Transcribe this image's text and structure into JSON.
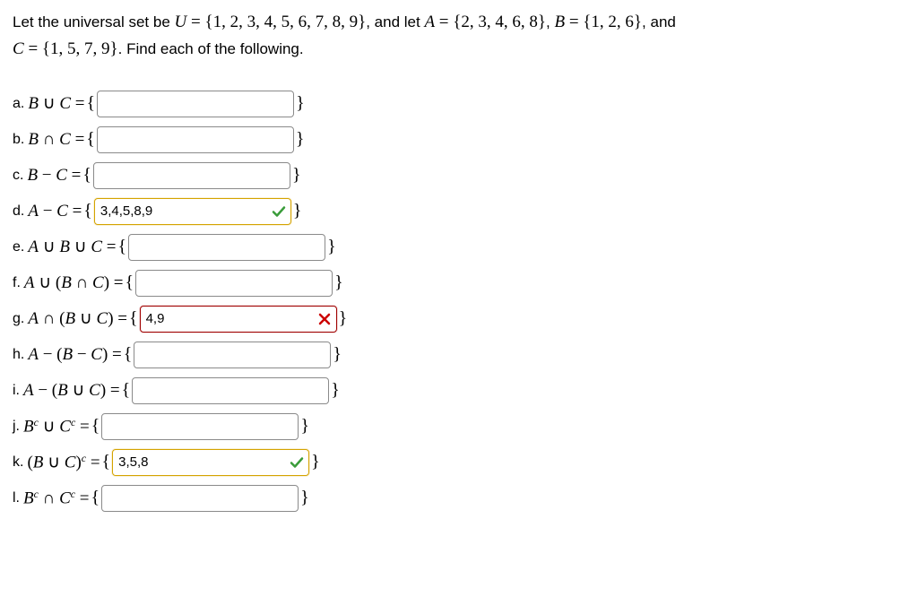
{
  "problem": {
    "text_prefix": "Let the universal set be ",
    "U_sym": "U",
    "U_set": " = {1, 2, 3, 4, 5, 6, 7, 8, 9}",
    "mid1": ", and let ",
    "A_sym": "A",
    "A_set": " = {2, 3, 4, 6, 8}",
    "sep1": ", ",
    "B_sym": "B",
    "B_set": " = {1, 2, 6}",
    "mid2": ", and",
    "C_sym": "C",
    "C_set": " = {1, 5, 7, 9}",
    "suffix": ". Find each of the following."
  },
  "parts": [
    {
      "letter": "a.",
      "expr_html": "<span class='math-i'>B</span> <span class='math'>∪</span> <span class='math-i'>C</span> <span class='math'>=</span>",
      "value": "",
      "status": ""
    },
    {
      "letter": "b.",
      "expr_html": "<span class='math-i'>B</span> <span class='math'>∩</span> <span class='math-i'>C</span> <span class='math'>=</span>",
      "value": "",
      "status": ""
    },
    {
      "letter": "c.",
      "expr_html": "<span class='math-i'>B</span> <span class='math'>−</span> <span class='math-i'>C</span> <span class='math'>=</span>",
      "value": "",
      "status": ""
    },
    {
      "letter": "d.",
      "expr_html": "<span class='math-i'>A</span> <span class='math'>−</span> <span class='math-i'>C</span> <span class='math'>=</span>",
      "value": "3,4,5,8,9",
      "status": "correct"
    },
    {
      "letter": "e.",
      "expr_html": "<span class='math-i'>A</span> <span class='math'>∪</span> <span class='math-i'>B</span> <span class='math'>∪</span> <span class='math-i'>C</span> <span class='math'>=</span>",
      "value": "",
      "status": ""
    },
    {
      "letter": "f.",
      "expr_html": "<span class='math-i'>A</span> <span class='math'>∪ (</span><span class='math-i'>B</span> <span class='math'>∩</span> <span class='math-i'>C</span><span class='math'>) =</span>",
      "value": "",
      "status": ""
    },
    {
      "letter": "g.",
      "expr_html": "<span class='math-i'>A</span> <span class='math'>∩ (</span><span class='math-i'>B</span> <span class='math'>∪</span> <span class='math-i'>C</span><span class='math'>) =</span>",
      "value": "4,9",
      "status": "incorrect"
    },
    {
      "letter": "h.",
      "expr_html": "<span class='math-i'>A</span> <span class='math'>− (</span><span class='math-i'>B</span> <span class='math'>−</span> <span class='math-i'>C</span><span class='math'>) =</span>",
      "value": "",
      "status": ""
    },
    {
      "letter": "i.",
      "expr_html": "<span class='math-i'>A</span> <span class='math'>− (</span><span class='math-i'>B</span> <span class='math'>∪</span> <span class='math-i'>C</span><span class='math'>) =</span>",
      "value": "",
      "status": ""
    },
    {
      "letter": "j.",
      "expr_html": "<span class='math-i'>B</span><span class='sup'>c</span> <span class='math'>∪</span> <span class='math-i'>C</span><span class='sup'>c</span> <span class='math'>=</span>",
      "value": "",
      "status": ""
    },
    {
      "letter": "k.",
      "expr_html": "<span class='math'>(</span><span class='math-i'>B</span> <span class='math'>∪</span> <span class='math-i'>C</span><span class='math'>)</span><span class='sup'>c</span> <span class='math'>=</span>",
      "value": "3,5,8",
      "status": "correct"
    },
    {
      "letter": "l.",
      "expr_html": "<span class='math-i'>B</span><span class='sup'>c</span> <span class='math'>∩</span> <span class='math-i'>C</span><span class='sup'>c</span> <span class='math'>=</span>",
      "value": "",
      "status": ""
    }
  ],
  "icons": {
    "check_color": "#3a9c3a",
    "x_color": "#cc0000"
  }
}
